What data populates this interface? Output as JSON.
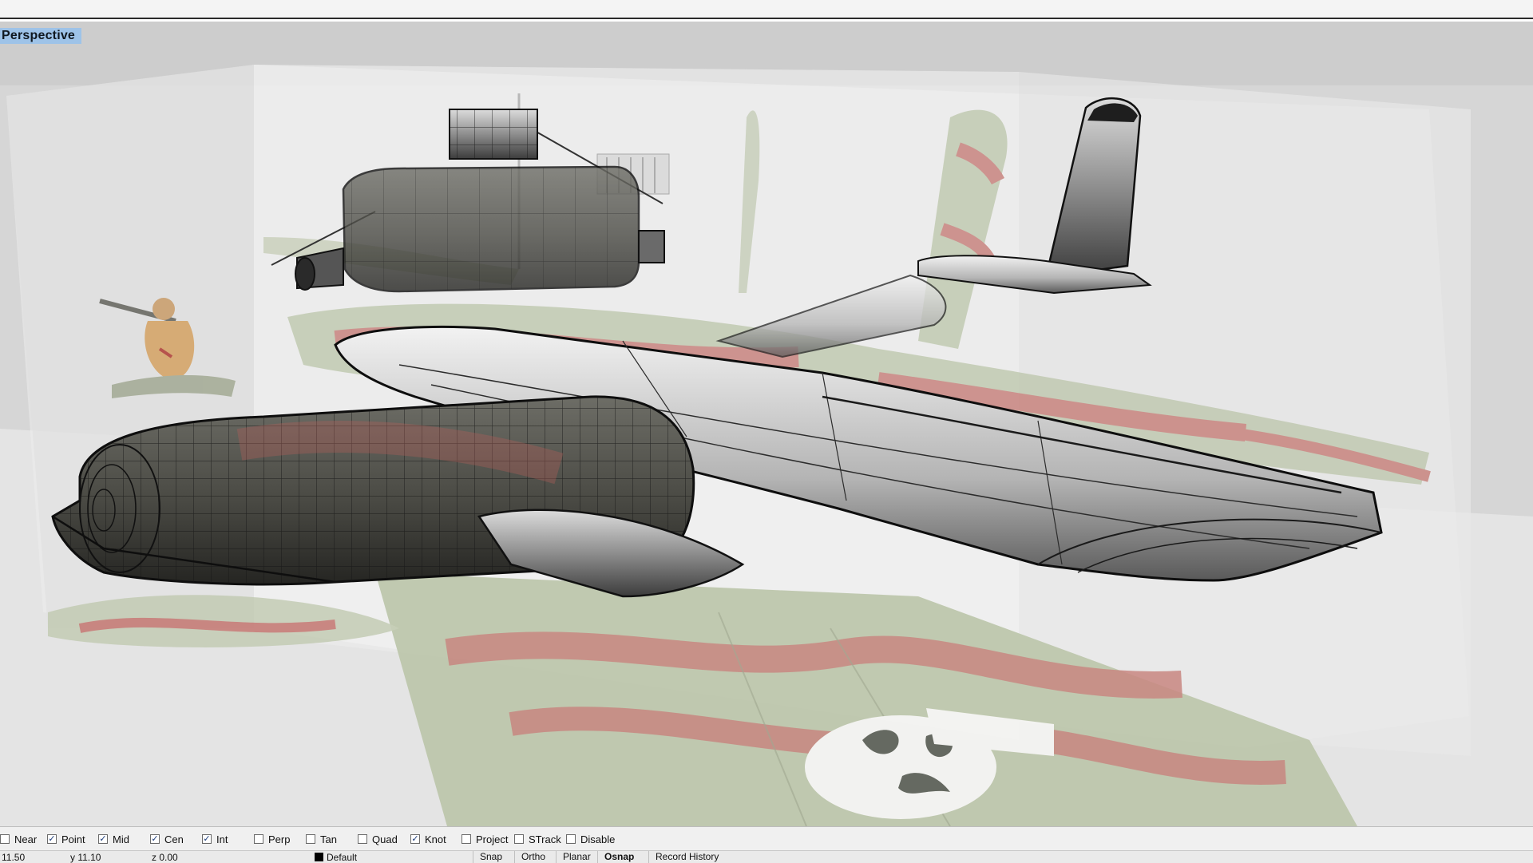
{
  "viewport": {
    "label": "Perspective",
    "colors": {
      "background": "#cfcfcf",
      "floor": "#e3e3e3",
      "camo_green": "#b9c4a6",
      "camo_red": "#c47a74",
      "surface_grey": "#8d8d8d",
      "wire": "#1a1a1a"
    }
  },
  "osnap": {
    "items": [
      {
        "label": "Near",
        "checked": false
      },
      {
        "label": "Point",
        "checked": true
      },
      {
        "label": "Mid",
        "checked": true
      },
      {
        "label": "Cen",
        "checked": true
      },
      {
        "label": "Int",
        "checked": true
      },
      {
        "label": "Perp",
        "checked": false
      },
      {
        "label": "Tan",
        "checked": false
      },
      {
        "label": "Quad",
        "checked": false
      },
      {
        "label": "Knot",
        "checked": true
      },
      {
        "label": "Project",
        "checked": false
      },
      {
        "label": "STrack",
        "checked": false
      },
      {
        "label": "Disable",
        "checked": false
      }
    ]
  },
  "status": {
    "x": "11.50",
    "y": "y 11.10",
    "z": "z 0.00",
    "layer": "Default",
    "panes": [
      "Snap",
      "Ortho",
      "Planar",
      "Osnap",
      "Record History"
    ],
    "active_pane": "Osnap"
  }
}
